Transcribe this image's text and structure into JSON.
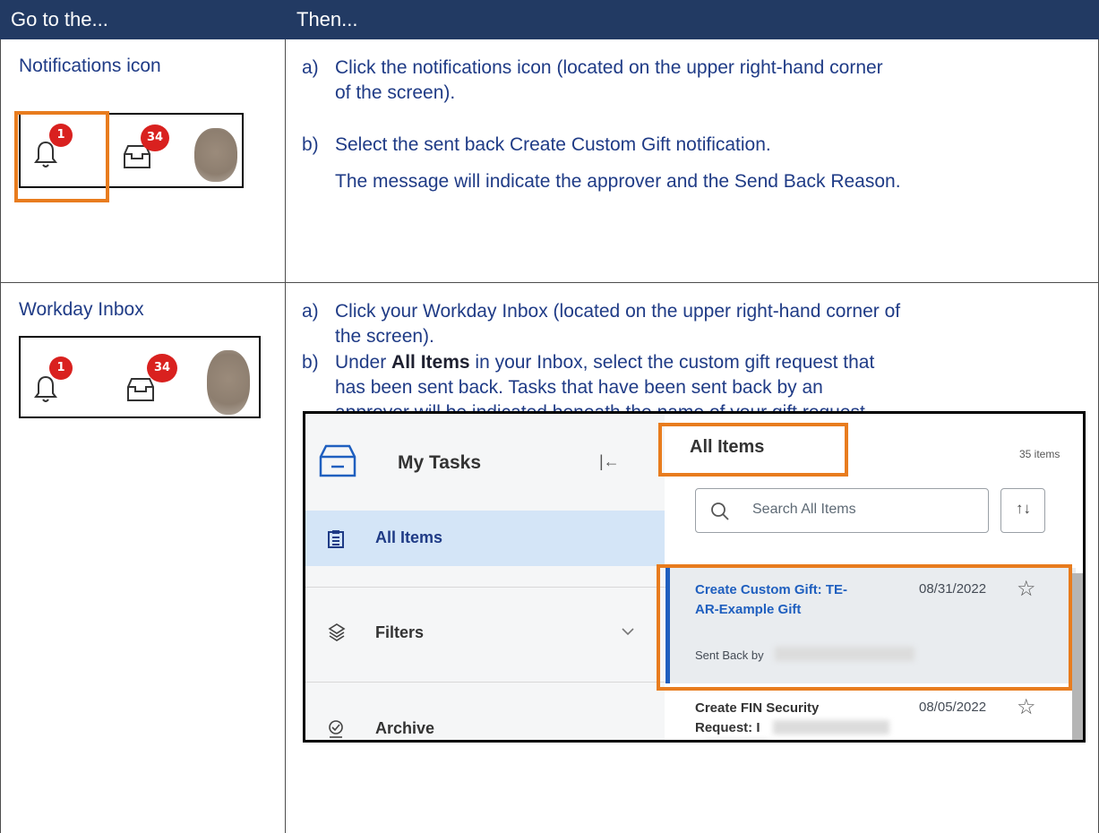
{
  "table": {
    "col1_header": "Go to the...",
    "col2_header": "Then..."
  },
  "row1": {
    "label": "Notifications icon",
    "notif_badge": "1",
    "inbox_badge": "34",
    "steps": [
      {
        "letter": "a)",
        "lines": [
          "Click the notifications icon (located on the upper right-hand corner",
          "of the screen)."
        ]
      },
      {
        "letter": "b)",
        "lines": [
          "Select the sent back Create Custom Gift notification."
        ]
      }
    ],
    "note": "The message will indicate the approver and the Send Back Reason."
  },
  "row2": {
    "label": "Workday Inbox",
    "notif_badge": "1",
    "inbox_badge": "34",
    "step_a_lines": [
      "Click your Workday Inbox (located on the upper right-hand corner of",
      "the screen)."
    ],
    "step_b_letter": "b)",
    "step_a_letter": "a)",
    "step_b_prefix": "Under ",
    "step_b_bold": "All Items",
    "step_b_rest": " in your Inbox, select the custom gift request that",
    "step_b_line2": "has been sent back. Tasks that have been sent back by an",
    "step_b_line3": "approver will be indicated beneath the name of your gift request."
  },
  "workday": {
    "title": "My Tasks",
    "nav": [
      {
        "label": "All Items",
        "icon": "clipboard-list-icon"
      },
      {
        "label": "Filters",
        "icon": "layers-icon"
      },
      {
        "label": "Archive",
        "icon": "check-circle-icon"
      }
    ],
    "list_title": "All Items",
    "count": "35 items",
    "search_placeholder": "Search All Items",
    "tasks": [
      {
        "title_line1": "Create Custom Gift: TE-",
        "title_line2": "AR-Example Gift",
        "date": "08/31/2022",
        "sub": "Sent Back by "
      },
      {
        "title_line1": "Create FIN Security",
        "title_line2": "Request: I",
        "date": "08/05/2022",
        "sub": ""
      }
    ],
    "colors": {
      "link": "#1f5fbf",
      "accent": "#1f5fbf",
      "highlight": "#e87c1e",
      "selected_nav": "#d4e5f7"
    }
  }
}
